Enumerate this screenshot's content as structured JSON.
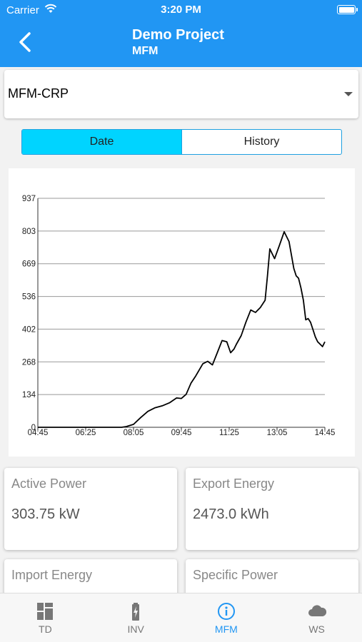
{
  "status": {
    "carrier": "Carrier",
    "time": "3:20 PM"
  },
  "header": {
    "title": "Demo Project",
    "subtitle": "MFM"
  },
  "picker": {
    "selected": "MFM-CRP"
  },
  "segments": {
    "date": "Date",
    "history": "History",
    "active": "Date"
  },
  "chart_data": {
    "type": "line",
    "yticks": [
      "937",
      "803",
      "669",
      "536",
      "402",
      "268",
      "134",
      "0"
    ],
    "xticks": [
      "04:45",
      "06:25",
      "08:05",
      "09:45",
      "11:25",
      "13:05",
      "14:45"
    ],
    "ylim": [
      0,
      937
    ],
    "xlim": [
      "04:45",
      "14:45"
    ],
    "grid": true,
    "series": [
      {
        "x": [
          "04:45",
          "07:40",
          "07:50",
          "08:05",
          "08:20",
          "08:35",
          "08:50",
          "09:05",
          "09:20",
          "09:35",
          "09:45",
          "09:55",
          "10:05",
          "10:15",
          "10:30",
          "10:40",
          "10:50",
          "11:00",
          "11:10",
          "11:20",
          "11:28",
          "11:35",
          "11:40",
          "11:50",
          "12:00",
          "12:10",
          "12:20",
          "12:30",
          "12:40",
          "12:45",
          "12:50",
          "13:00",
          "13:10",
          "13:20",
          "13:30",
          "13:40",
          "13:45",
          "13:50",
          "13:55",
          "14:00",
          "14:05",
          "14:10",
          "14:15",
          "14:20",
          "14:25",
          "14:30",
          "14:35",
          "14:40",
          "14:45"
        ],
        "values": [
          0,
          0,
          3,
          12,
          40,
          65,
          80,
          88,
          100,
          120,
          118,
          135,
          180,
          210,
          260,
          270,
          255,
          305,
          355,
          350,
          305,
          320,
          340,
          375,
          430,
          480,
          470,
          490,
          520,
          620,
          730,
          690,
          745,
          800,
          760,
          650,
          620,
          610,
          570,
          520,
          440,
          445,
          430,
          400,
          370,
          350,
          340,
          330,
          350
        ]
      }
    ]
  },
  "cards": [
    {
      "label": "Active Power",
      "value": "303.75 kW"
    },
    {
      "label": "Export Energy",
      "value": "2473.0 kWh"
    },
    {
      "label": "Import Energy",
      "value": ""
    },
    {
      "label": "Specific Power",
      "value": ""
    }
  ],
  "tabs": [
    {
      "label": "TD",
      "icon": "dashboard-icon"
    },
    {
      "label": "INV",
      "icon": "battery-charging-icon"
    },
    {
      "label": "MFM",
      "icon": "info-icon",
      "active": true
    },
    {
      "label": "WS",
      "icon": "cloud-icon"
    }
  ],
  "colors": {
    "primary": "#2196f3",
    "segment_active": "#00d4ff"
  }
}
